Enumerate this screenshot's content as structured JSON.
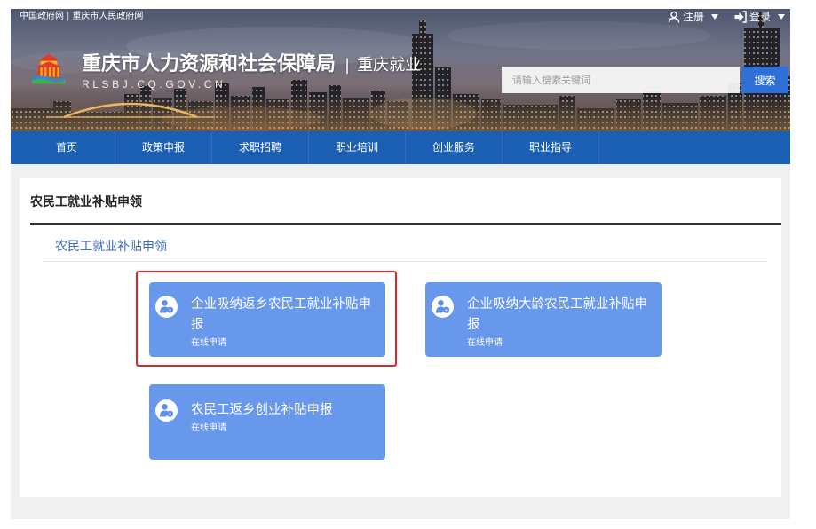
{
  "top_links": {
    "items": [
      "中国政府网",
      "重庆市人民政府网"
    ],
    "separator": "|"
  },
  "user_menu": {
    "register_label": "注册",
    "register_icon": "user-icon",
    "login_label": "登录",
    "login_icon": "sign-in-icon",
    "dropdown_icon": "caret-down-icon"
  },
  "site": {
    "logo_icon": "bureau-logo",
    "title": "重庆市人力资源和社会保障局",
    "divider": "|",
    "subtitle": "重庆就业",
    "domain": "RLSBJ.CQ.GOV.CN"
  },
  "search": {
    "placeholder": "请输入搜索关键词",
    "button_label": "搜索"
  },
  "nav": [
    {
      "label": "首页"
    },
    {
      "label": "政策申报"
    },
    {
      "label": "求职招聘"
    },
    {
      "label": "职业培训"
    },
    {
      "label": "创业服务"
    },
    {
      "label": "职业指导"
    }
  ],
  "page": {
    "heading": "农民工就业补贴申领",
    "section_title": "农民工就业补贴申领"
  },
  "services": [
    {
      "title": "企业吸纳返乡农民工就业补贴申报",
      "action_label": "在线申请",
      "icon": "applicant-icon"
    },
    {
      "title": "企业吸纳大龄农民工就业补贴申报",
      "action_label": "在线申请",
      "icon": "applicant-icon"
    },
    {
      "title": "农民工返乡创业补贴申报",
      "action_label": "在线申请",
      "icon": "applicant-icon"
    }
  ],
  "highlighted_service_index": 0,
  "colors": {
    "nav_bg": "#1b5fb5",
    "search_button": "#2f70d6",
    "service_card": "#6898ec",
    "section_title": "#3e6bbd",
    "highlight_border": "#e0262b",
    "page_bg": "#f0f0f0"
  }
}
